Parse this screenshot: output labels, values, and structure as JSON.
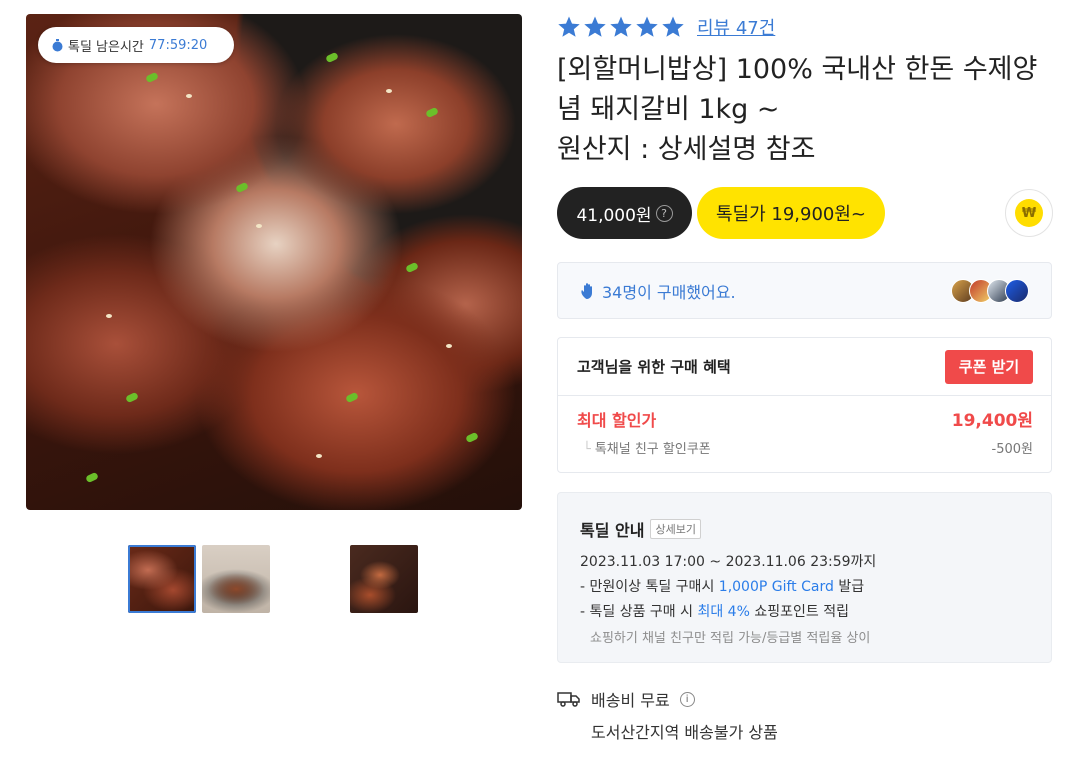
{
  "gallery": {
    "timer_label": "톡딜 남은시간",
    "timer_value": "77:59:20"
  },
  "rating": {
    "stars": 5,
    "review_link": "리뷰 47건"
  },
  "product": {
    "title": "[외할머니밥상] 100% 국내산 한돈 수제양념 돼지갈비 1kg ~\n원산지 : 상세설명 참조"
  },
  "price": {
    "original": "41,000원",
    "help_glyph": "?",
    "deal": "톡딜가 19,900원~",
    "won_glyph": "₩"
  },
  "buyers": {
    "text": "34명이 구매했어요."
  },
  "coupon": {
    "title": "고객님을 위한 구매 혜택",
    "button": "쿠폰 받기",
    "max_label": "최대 할인가",
    "max_value": "19,400원",
    "sub_label": "톡채널 친구 할인쿠폰",
    "sub_value": "-500원"
  },
  "deal_info": {
    "title": "톡딜 안내",
    "detail_button": "상세보기",
    "period": "2023.11.03 17:00 ~ 2023.11.06 23:59까지",
    "line1_a": "- 만원이상 톡딜 구매시 ",
    "line1_highlight": "1,000P Gift Card",
    "line1_b": " 발급",
    "line2_a": "- 톡딜 상품 구매 시 ",
    "line2_highlight": "최대 4%",
    "line2_b": " 쇼핑포인트 적립",
    "note": "쇼핑하기 채널 친구만 적립 가능/등급별 적립율 상이"
  },
  "shipping": {
    "label": "배송비 무료",
    "info_glyph": "i",
    "note": "도서산간지역 배송불가 상품"
  },
  "colors": {
    "accent_blue": "#3b7bd4",
    "deal_yellow": "#ffe300",
    "coupon_red": "#f04a4a"
  }
}
